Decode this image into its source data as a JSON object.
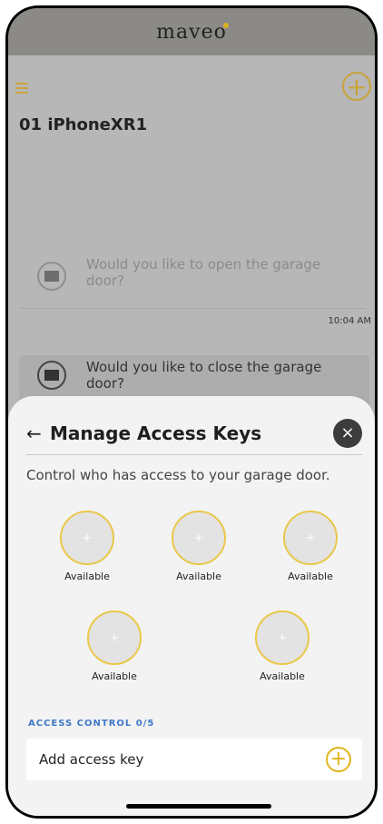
{
  "app": {
    "brand": "maveo"
  },
  "background": {
    "device_name": "01 iPhoneXR1",
    "messages": [
      {
        "text": "Would you like to open the garage door?",
        "icon": "garage-icon"
      },
      {
        "text": "Would you like to close the garage door?",
        "icon": "garage-icon"
      }
    ],
    "timestamp": "10:04 AM"
  },
  "sheet": {
    "back_icon": "←",
    "title": "Manage Access Keys",
    "close_icon": "×",
    "subtitle": "Control who has access to your garage door.",
    "slots": [
      {
        "label": "Available",
        "icon": "+"
      },
      {
        "label": "Available",
        "icon": "+"
      },
      {
        "label": "Available",
        "icon": "+"
      },
      {
        "label": "Available",
        "icon": "+"
      },
      {
        "label": "Available",
        "icon": "+"
      }
    ],
    "access_heading": "ACCESS CONTROL 0/5",
    "add_key_label": "Add access key",
    "add_key_icon": "+"
  },
  "colors": {
    "accent_gold": "#e0b419",
    "heading_blue": "#3f79c8",
    "close_dark": "#3c3c3c"
  }
}
